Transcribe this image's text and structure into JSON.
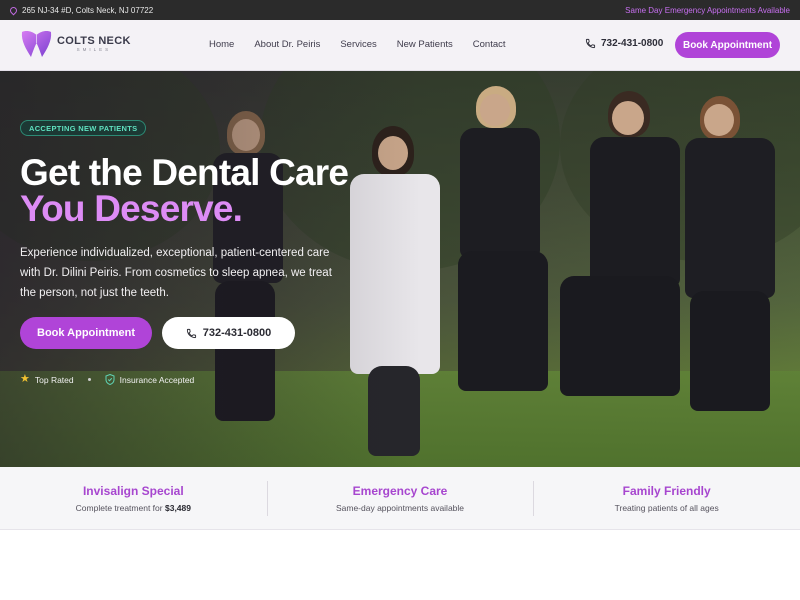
{
  "topbar": {
    "address": "265 NJ-34 #D, Colts Neck, NJ 07722",
    "emergency": "Same Day Emergency Appointments Available"
  },
  "nav": {
    "logo_line1": "COLTS NECK",
    "logo_line2": "SMILES",
    "links": [
      "Home",
      "About Dr. Peiris",
      "Services",
      "New Patients",
      "Contact"
    ],
    "phone": "732-431-0800",
    "cta": "Book Appointment"
  },
  "hero": {
    "badge": "ACCEPTING NEW PATIENTS",
    "heading_line1": "Get the Dental Care",
    "heading_line2": "You Deserve.",
    "subtext": "Experience individualized, exceptional, patient-centered care with Dr. Dilini Peiris. From cosmetics to sleep apnea, we treat the person, not just the teeth.",
    "book_button": "Book Appointment",
    "call_button": "732-431-0800",
    "trust": [
      "Top Rated",
      "Insurance Accepted"
    ]
  },
  "features": [
    {
      "title": "Invisalign Special",
      "desc_prefix": "Complete treatment for",
      "desc_strong": "$3,489"
    },
    {
      "title": "Emergency Care",
      "desc": "Same-day appointments available"
    },
    {
      "title": "Family Friendly",
      "desc": "Treating patients of all ages"
    }
  ],
  "colors": {
    "accent": "#b044d8",
    "accent_light": "#dd8cf5",
    "badge_text": "#5fe0bf",
    "topbar_bg": "#2b2b2b",
    "star": "#f2c230"
  },
  "icons": {
    "address": "map-pin-icon",
    "phone": "phone-icon",
    "top_rated": "star-icon",
    "insurance": "shield-icon"
  }
}
